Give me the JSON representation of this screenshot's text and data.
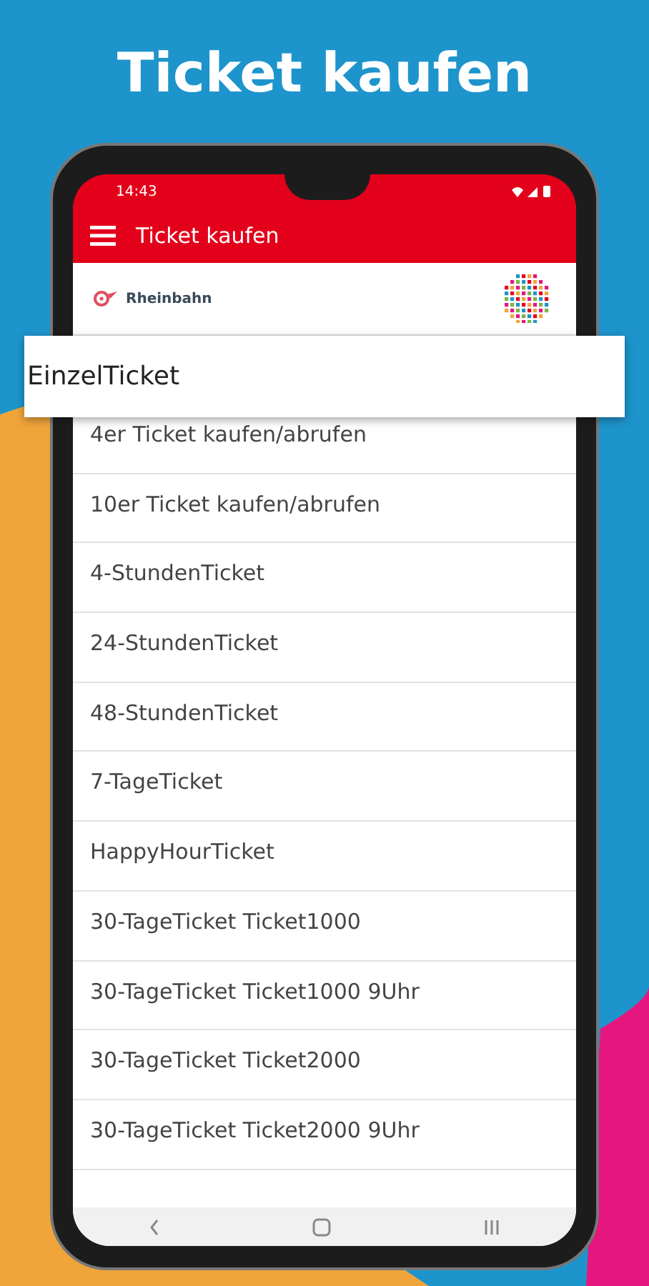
{
  "headline": "Ticket kaufen",
  "status_bar": {
    "time": "14:43"
  },
  "app_bar": {
    "title": "Ticket kaufen"
  },
  "brand": {
    "name": "Rheinbahn"
  },
  "highlighted_item": {
    "label": "EinzelTicket"
  },
  "tickets": [
    {
      "label": "4er Ticket kaufen/abrufen"
    },
    {
      "label": "10er Ticket kaufen/abrufen"
    },
    {
      "label": "4-StundenTicket"
    },
    {
      "label": "24-StundenTicket"
    },
    {
      "label": "48-StundenTicket"
    },
    {
      "label": "7-TageTicket"
    },
    {
      "label": "HappyHourTicket"
    },
    {
      "label": "30-TageTicket Ticket1000"
    },
    {
      "label": "30-TageTicket Ticket1000 9Uhr"
    },
    {
      "label": "30-TageTicket Ticket2000"
    },
    {
      "label": "30-TageTicket Ticket2000 9Uhr"
    }
  ]
}
